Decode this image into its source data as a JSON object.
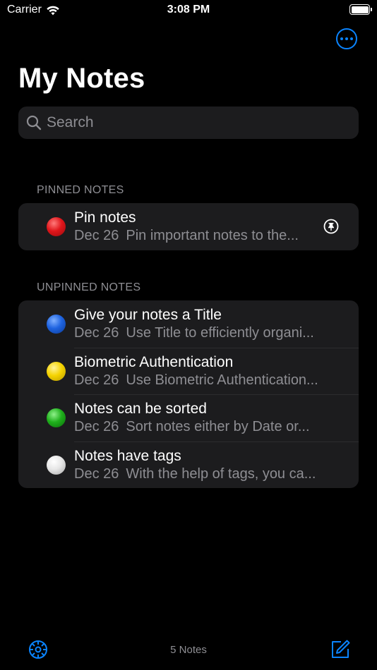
{
  "status_bar": {
    "carrier": "Carrier",
    "time": "3:08 PM"
  },
  "header": {
    "title": "My Notes",
    "more_icon": "ellipsis-circle-icon"
  },
  "search": {
    "placeholder": "Search"
  },
  "sections": {
    "pinned": {
      "header": "PINNED NOTES",
      "notes": [
        {
          "title": "Pin notes",
          "date": "Dec 26",
          "preview": "Pin important notes to the...",
          "color": "#e0161b",
          "pinned": true
        }
      ]
    },
    "unpinned": {
      "header": "UNPINNED NOTES",
      "notes": [
        {
          "title": "Give your notes a Title",
          "date": "Dec 26",
          "preview": "Use Title to efficiently organi...",
          "color": "#1e63e0"
        },
        {
          "title": "Biometric Authentication",
          "date": "Dec 26",
          "preview": "Use Biometric Authentication...",
          "color": "#f5d300"
        },
        {
          "title": "Notes can be sorted",
          "date": "Dec 26",
          "preview": "Sort notes either by Date or...",
          "color": "#1fb01c"
        },
        {
          "title": "Notes have tags",
          "date": "Dec 26",
          "preview": "With the help of tags, you ca...",
          "color": "#e6e6e6"
        }
      ]
    }
  },
  "toolbar": {
    "count_label": "5 Notes",
    "settings_icon": "settings-gear-icon",
    "compose_icon": "compose-icon"
  },
  "colors": {
    "accent": "#0a84ff",
    "background": "#000000",
    "cell": "#1c1c1e",
    "secondary_text": "#8e8e93"
  }
}
